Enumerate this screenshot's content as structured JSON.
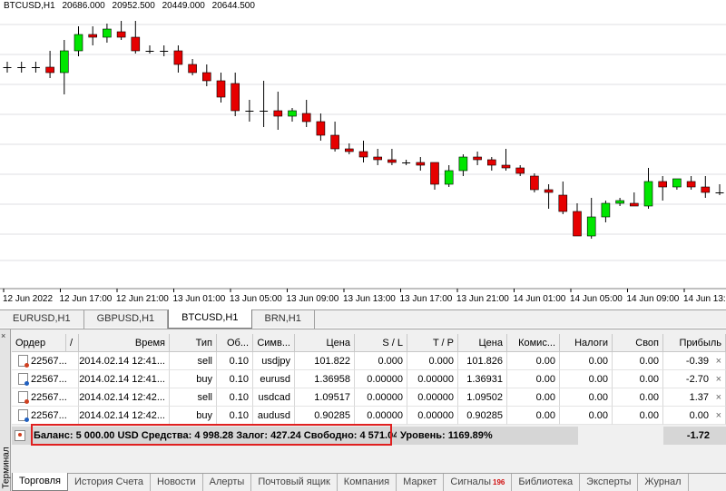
{
  "chart": {
    "symbol": "BTCUSD,H1",
    "ohlc": [
      "20686.000",
      "20952.500",
      "20449.000",
      "20644.500"
    ],
    "time_labels": [
      "12 Jun 2022",
      "12 Jun 17:00",
      "12 Jun 21:00",
      "13 Jun 01:00",
      "13 Jun 05:00",
      "13 Jun 09:00",
      "13 Jun 13:00",
      "13 Jun 17:00",
      "13 Jun 21:00",
      "14 Jun 01:00",
      "14 Jun 05:00",
      "14 Jun 09:00",
      "14 Jun 13:00"
    ],
    "colors": {
      "bull": "#00e600",
      "bear": "#e60000",
      "wick": "#000000",
      "grid": "#c0c0c8"
    }
  },
  "chart_data": {
    "type": "candlestick",
    "title": "BTCUSD,H1",
    "series": [
      {
        "o": 0.2,
        "h": 0.18,
        "l": 0.22,
        "c": 0.2
      },
      {
        "o": 0.2,
        "h": 0.18,
        "l": 0.22,
        "c": 0.2
      },
      {
        "o": 0.2,
        "h": 0.18,
        "l": 0.22,
        "c": 0.2
      },
      {
        "o": 0.2,
        "h": 0.14,
        "l": 0.24,
        "c": 0.22
      },
      {
        "o": 0.22,
        "h": 0.1,
        "l": 0.3,
        "c": 0.14
      },
      {
        "o": 0.14,
        "h": 0.05,
        "l": 0.16,
        "c": 0.08
      },
      {
        "o": 0.08,
        "h": 0.05,
        "l": 0.12,
        "c": 0.09
      },
      {
        "o": 0.09,
        "h": 0.04,
        "l": 0.11,
        "c": 0.06
      },
      {
        "o": 0.07,
        "h": 0.03,
        "l": 0.1,
        "c": 0.09
      },
      {
        "o": 0.09,
        "h": 0.03,
        "l": 0.15,
        "c": 0.14
      },
      {
        "o": 0.14,
        "h": 0.12,
        "l": 0.15,
        "c": 0.14
      },
      {
        "o": 0.14,
        "h": 0.12,
        "l": 0.16,
        "c": 0.14
      },
      {
        "o": 0.14,
        "h": 0.12,
        "l": 0.22,
        "c": 0.19
      },
      {
        "o": 0.19,
        "h": 0.17,
        "l": 0.23,
        "c": 0.22
      },
      {
        "o": 0.22,
        "h": 0.19,
        "l": 0.27,
        "c": 0.25
      },
      {
        "o": 0.25,
        "h": 0.22,
        "l": 0.33,
        "c": 0.31
      },
      {
        "o": 0.26,
        "h": 0.22,
        "l": 0.38,
        "c": 0.36
      },
      {
        "o": 0.36,
        "h": 0.32,
        "l": 0.4,
        "c": 0.36
      },
      {
        "o": 0.36,
        "h": 0.25,
        "l": 0.42,
        "c": 0.36
      },
      {
        "o": 0.36,
        "h": 0.29,
        "l": 0.43,
        "c": 0.38
      },
      {
        "o": 0.38,
        "h": 0.35,
        "l": 0.4,
        "c": 0.36
      },
      {
        "o": 0.37,
        "h": 0.32,
        "l": 0.42,
        "c": 0.4
      },
      {
        "o": 0.4,
        "h": 0.37,
        "l": 0.47,
        "c": 0.45
      },
      {
        "o": 0.45,
        "h": 0.4,
        "l": 0.51,
        "c": 0.5
      },
      {
        "o": 0.5,
        "h": 0.48,
        "l": 0.52,
        "c": 0.51
      },
      {
        "o": 0.51,
        "h": 0.47,
        "l": 0.55,
        "c": 0.53
      },
      {
        "o": 0.53,
        "h": 0.5,
        "l": 0.56,
        "c": 0.54
      },
      {
        "o": 0.54,
        "h": 0.5,
        "l": 0.56,
        "c": 0.55
      },
      {
        "o": 0.55,
        "h": 0.54,
        "l": 0.56,
        "c": 0.55
      },
      {
        "o": 0.55,
        "h": 0.53,
        "l": 0.58,
        "c": 0.56
      },
      {
        "o": 0.55,
        "h": 0.55,
        "l": 0.65,
        "c": 0.63
      },
      {
        "o": 0.63,
        "h": 0.56,
        "l": 0.64,
        "c": 0.58
      },
      {
        "o": 0.58,
        "h": 0.52,
        "l": 0.6,
        "c": 0.53
      },
      {
        "o": 0.53,
        "h": 0.51,
        "l": 0.56,
        "c": 0.54
      },
      {
        "o": 0.54,
        "h": 0.53,
        "l": 0.58,
        "c": 0.56
      },
      {
        "o": 0.56,
        "h": 0.5,
        "l": 0.58,
        "c": 0.57
      },
      {
        "o": 0.57,
        "h": 0.56,
        "l": 0.6,
        "c": 0.59
      },
      {
        "o": 0.6,
        "h": 0.59,
        "l": 0.66,
        "c": 0.65
      },
      {
        "o": 0.65,
        "h": 0.63,
        "l": 0.72,
        "c": 0.66
      },
      {
        "o": 0.67,
        "h": 0.62,
        "l": 0.74,
        "c": 0.73
      },
      {
        "o": 0.73,
        "h": 0.7,
        "l": 0.81,
        "c": 0.82
      },
      {
        "o": 0.82,
        "h": 0.68,
        "l": 0.83,
        "c": 0.75
      },
      {
        "o": 0.75,
        "h": 0.69,
        "l": 0.77,
        "c": 0.7
      },
      {
        "o": 0.7,
        "h": 0.68,
        "l": 0.71,
        "c": 0.69
      },
      {
        "o": 0.7,
        "h": 0.66,
        "l": 0.71,
        "c": 0.71
      },
      {
        "o": 0.71,
        "h": 0.57,
        "l": 0.72,
        "c": 0.62
      },
      {
        "o": 0.62,
        "h": 0.6,
        "l": 0.69,
        "c": 0.64
      },
      {
        "o": 0.64,
        "h": 0.61,
        "l": 0.65,
        "c": 0.61
      },
      {
        "o": 0.62,
        "h": 0.6,
        "l": 0.65,
        "c": 0.64
      },
      {
        "o": 0.64,
        "h": 0.6,
        "l": 0.68,
        "c": 0.66
      },
      {
        "o": 0.66,
        "h": 0.63,
        "l": 0.67,
        "c": 0.66
      },
      {
        "o": 0.66,
        "h": 0.63,
        "l": 0.7,
        "c": 0.67
      },
      {
        "o": 0.67,
        "h": 0.62,
        "l": 0.7,
        "c": 0.68
      },
      {
        "o": 0.68,
        "h": 0.62,
        "l": 0.7,
        "c": 0.67
      },
      {
        "o": 0.68,
        "h": 0.64,
        "l": 0.72,
        "c": 0.67
      }
    ]
  },
  "chart_tabs": [
    "EURUSD,H1",
    "GBPUSD,H1",
    "BTCUSD,H1",
    "BRN,H1"
  ],
  "active_chart_tab": "BTCUSD,H1",
  "terminal": {
    "side_label": "Терминал",
    "columns": [
      "Ордер",
      "/",
      "Время",
      "Тип",
      "Об...",
      "Симв...",
      "Цена",
      "S / L",
      "T / P",
      "Цена",
      "Комис...",
      "Налоги",
      "Своп",
      "Прибыль"
    ],
    "orders": [
      {
        "order": "22567...",
        "time": "2014.02.14 12:41...",
        "type": "sell",
        "volume": "0.10",
        "symbol": "usdjpy",
        "price": "101.822",
        "sl": "0.000",
        "tp": "0.000",
        "cur_price": "101.826",
        "commission": "0.00",
        "taxes": "0.00",
        "swap": "0.00",
        "profit": "-0.39",
        "close": "×"
      },
      {
        "order": "22567...",
        "time": "2014.02.14 12:41...",
        "type": "buy",
        "volume": "0.10",
        "symbol": "eurusd",
        "price": "1.36958",
        "sl": "0.00000",
        "tp": "0.00000",
        "cur_price": "1.36931",
        "commission": "0.00",
        "taxes": "0.00",
        "swap": "0.00",
        "profit": "-2.70",
        "close": "×"
      },
      {
        "order": "22567...",
        "time": "2014.02.14 12:42...",
        "type": "sell",
        "volume": "0.10",
        "symbol": "usdcad",
        "price": "1.09517",
        "sl": "0.00000",
        "tp": "0.00000",
        "cur_price": "1.09502",
        "commission": "0.00",
        "taxes": "0.00",
        "swap": "0.00",
        "profit": "1.37",
        "close": "×"
      },
      {
        "order": "22567...",
        "time": "2014.02.14 12:42...",
        "type": "buy",
        "volume": "0.10",
        "symbol": "audusd",
        "price": "0.90285",
        "sl": "0.00000",
        "tp": "0.00000",
        "cur_price": "0.90285",
        "commission": "0.00",
        "taxes": "0.00",
        "swap": "0.00",
        "profit": "0.00",
        "close": "×"
      }
    ],
    "summary": {
      "text": "Баланс: 5 000.00 USD  Средства: 4 998.28  Залог: 427.24  Свободно: 4 571.04",
      "level": "Уровень: 1169.89%",
      "total_profit": "-1.72"
    }
  },
  "bottom_tabs": [
    {
      "label": "Торговля",
      "active": true
    },
    {
      "label": "История Счета"
    },
    {
      "label": "Новости"
    },
    {
      "label": "Алерты"
    },
    {
      "label": "Почтовый ящик"
    },
    {
      "label": "Компания"
    },
    {
      "label": "Маркет"
    },
    {
      "label": "Сигналы",
      "badge": "196"
    },
    {
      "label": "Библиотека"
    },
    {
      "label": "Эксперты"
    },
    {
      "label": "Журнал"
    }
  ]
}
